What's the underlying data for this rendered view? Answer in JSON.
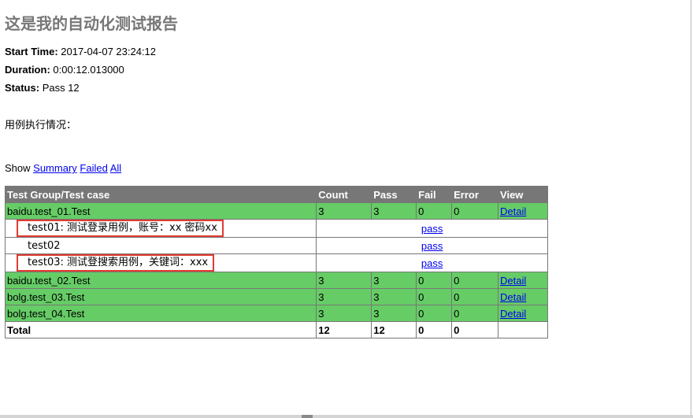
{
  "report": {
    "heading": "这是我的自动化测试报告",
    "start_time_label": "Start Time:",
    "start_time": "2017-04-07 23:24:12",
    "duration_label": "Duration:",
    "duration": "0:00:12.013000",
    "status_label": "Status:",
    "status": "Pass 12",
    "description": "用例执行情况："
  },
  "show_bar": {
    "label": "Show",
    "summary": "Summary",
    "failed": "Failed",
    "all": "All"
  },
  "table": {
    "headers": [
      "Test Group/Test case",
      "Count",
      "Pass",
      "Fail",
      "Error",
      "View"
    ],
    "groups": [
      {
        "name": "baidu.test_01.Test",
        "count": "3",
        "pass": "3",
        "fail": "0",
        "error": "0",
        "view": "Detail"
      },
      {
        "name": "baidu.test_02.Test",
        "count": "3",
        "pass": "3",
        "fail": "0",
        "error": "0",
        "view": "Detail"
      },
      {
        "name": "bolg.test_03.Test",
        "count": "3",
        "pass": "3",
        "fail": "0",
        "error": "0",
        "view": "Detail"
      },
      {
        "name": "bolg.test_04.Test",
        "count": "3",
        "pass": "3",
        "fail": "0",
        "error": "0",
        "view": "Detail"
      }
    ],
    "cases": [
      {
        "name": "test01: 测试登录用例，账号：xx 密码xx",
        "result": "pass"
      },
      {
        "name": "test02",
        "result": "pass"
      },
      {
        "name": "test03: 测试登搜索用例，关键词：xxx",
        "result": "pass"
      }
    ],
    "total": {
      "label": "Total",
      "count": "12",
      "pass": "12",
      "fail": "0",
      "error": "0"
    }
  },
  "colors": {
    "header_bg": "#777777",
    "pass_row": "#66cc66",
    "highlight_box": "#e03c31",
    "link": "#0000ee"
  }
}
